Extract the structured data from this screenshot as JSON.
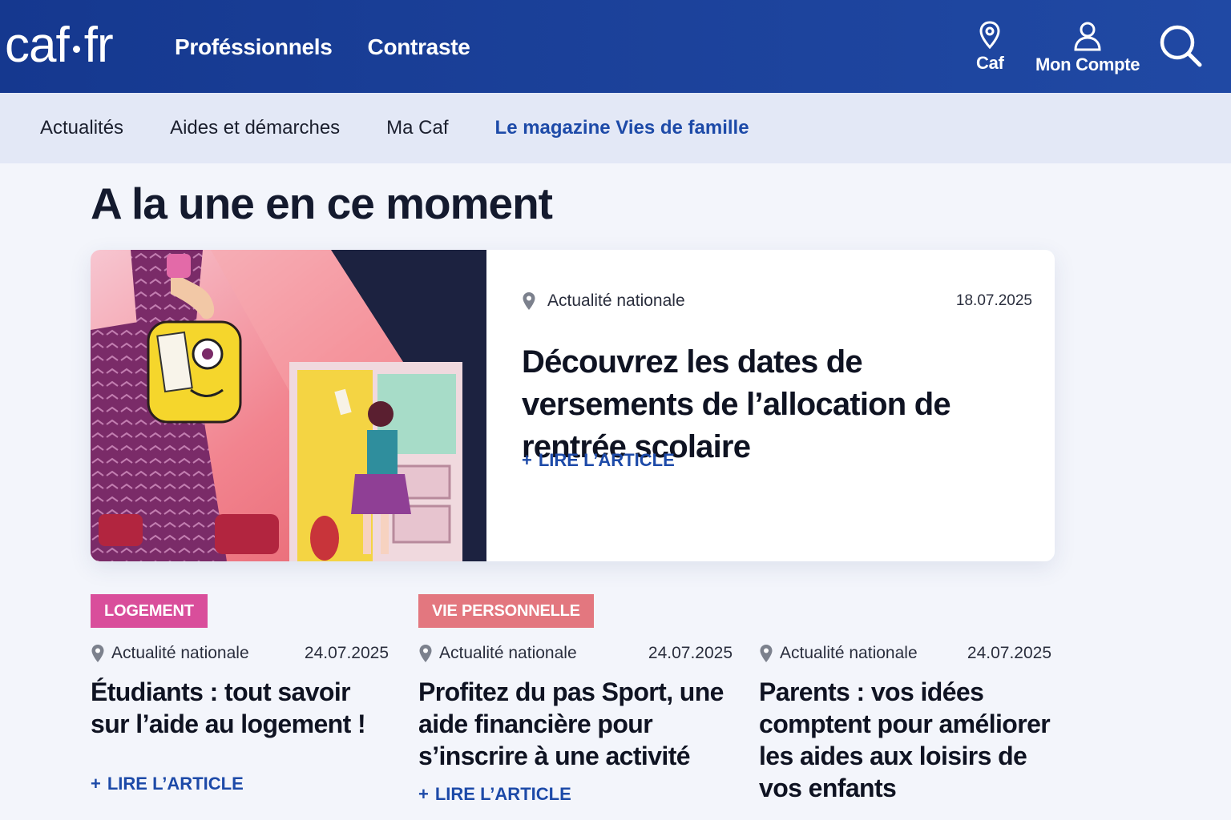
{
  "header": {
    "logo": {
      "left": "caf",
      "right": "fr"
    },
    "nav": [
      "Proféssionnels",
      "Contraste"
    ],
    "utilities": {
      "caf_label": "Caf",
      "account_label": "Mon Compte"
    },
    "icons": [
      "location-pin-icon",
      "user-icon",
      "search-icon"
    ]
  },
  "subnav": {
    "items": [
      "Actualités",
      "Aides et démarches",
      "Ma Caf",
      "Le magazine Vies de famille"
    ],
    "active_index": 3
  },
  "section_title": "A la une en ce moment",
  "featured": {
    "location": "Actualité nationale",
    "date": "18.07.2025",
    "title": "Découvrez les dates de versements de l’allocation de rentrée scolaire",
    "link": "LIRE L’ARTICLE",
    "link_prefix": "+"
  },
  "cards": [
    {
      "tag": "LOGEMENT",
      "tag_color": "#d94e9b",
      "location": "Actualité nationale",
      "date": "24.07.2025",
      "title": "Étudiants : tout savoir sur l’aide au logement !",
      "link": "LIRE L’ARTICLE",
      "link_prefix": "+"
    },
    {
      "tag": "VIE PERSONNELLE",
      "tag_color": "#e3777f",
      "location": "Actualité nationale",
      "date": "24.07.2025",
      "title": "Profitez du pas Sport, une aide financière pour s’inscrire à une activité",
      "link": "LIRE L’ARTICLE",
      "link_prefix": "+"
    },
    {
      "tag": "",
      "location": "Actualité nationale",
      "date": "24.07.2025",
      "title": "Parents : vos idées comptent pour améliorer les aides aux loisirs de vos enfants",
      "link": "",
      "link_prefix": ""
    }
  ],
  "colors": {
    "header_bg": "#1c429b",
    "subnav_bg": "#e3e8f6",
    "accent_link": "#1d4aa8",
    "page_bg": "#f3f5fb"
  }
}
